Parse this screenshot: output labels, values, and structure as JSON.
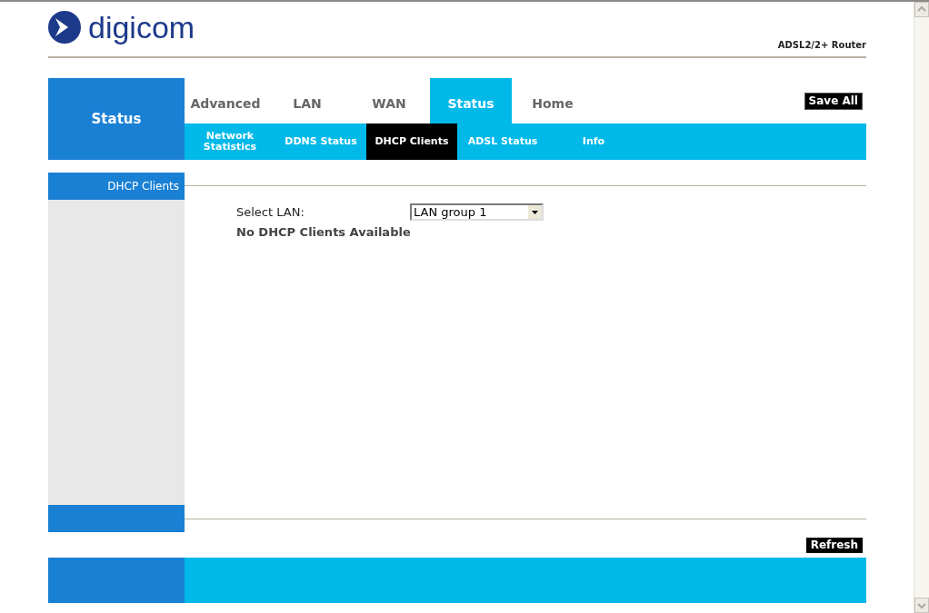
{
  "logo": {
    "text": "digicom"
  },
  "product": "ADSL2/2+ Router",
  "section_title": "Status",
  "tabs": [
    {
      "label": "Advanced",
      "selected": false
    },
    {
      "label": "LAN",
      "selected": false
    },
    {
      "label": "WAN",
      "selected": false
    },
    {
      "label": "Status",
      "selected": true
    },
    {
      "label": "Home",
      "selected": false
    }
  ],
  "save_button": "Save All",
  "subtabs": [
    {
      "label": "Network Statistics",
      "selected": false
    },
    {
      "label": "DDNS Status",
      "selected": false
    },
    {
      "label": "DHCP Clients",
      "selected": true
    },
    {
      "label": "ADSL Status",
      "selected": false
    },
    {
      "label": "Info",
      "selected": false
    }
  ],
  "sidebar": {
    "header": "DHCP Clients"
  },
  "form": {
    "label": "Select LAN:",
    "value": "LAN group 1",
    "message": "No DHCP Clients Available"
  },
  "refresh_button": "Refresh"
}
